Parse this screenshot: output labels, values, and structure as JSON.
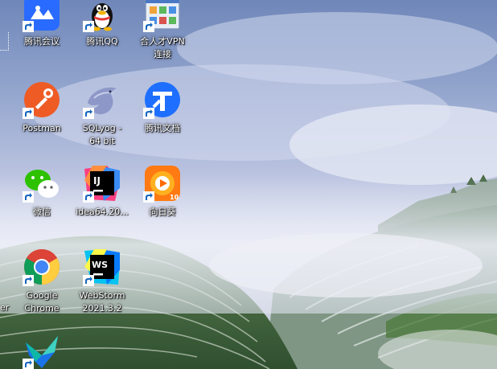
{
  "desktop": {
    "edge_label": "er",
    "icons": [
      {
        "label": "腾讯会议",
        "icon": "tencent-meeting-icon"
      },
      {
        "label": "腾讯QQ",
        "icon": "qq-penguin-icon"
      },
      {
        "label": "合人才VPN\n连接",
        "icon": "vpn-app-icon"
      },
      {
        "label": "Postman",
        "icon": "postman-icon"
      },
      {
        "label": "SQLyog -\n64 bit",
        "icon": "sqlyog-dolphin-icon"
      },
      {
        "label": "腾讯文档",
        "icon": "tencent-docs-icon"
      },
      {
        "label": "微信",
        "icon": "wechat-icon"
      },
      {
        "label": "idea64.20...",
        "icon": "intellij-idea-icon"
      },
      {
        "label": "向日葵",
        "icon": "sunflower-remote-icon"
      },
      {
        "label": "Google\nChrome",
        "icon": "chrome-icon"
      },
      {
        "label": "WebStorm\n2021.3.2",
        "icon": "webstorm-icon"
      },
      {
        "label": "",
        "icon": "blue-bird-app-icon"
      }
    ],
    "colors": {
      "sky_top": "#6f87b9",
      "mist": "#d8dcee",
      "terrace_green": "#3f6e3c",
      "label_text": "#ffffff"
    }
  }
}
